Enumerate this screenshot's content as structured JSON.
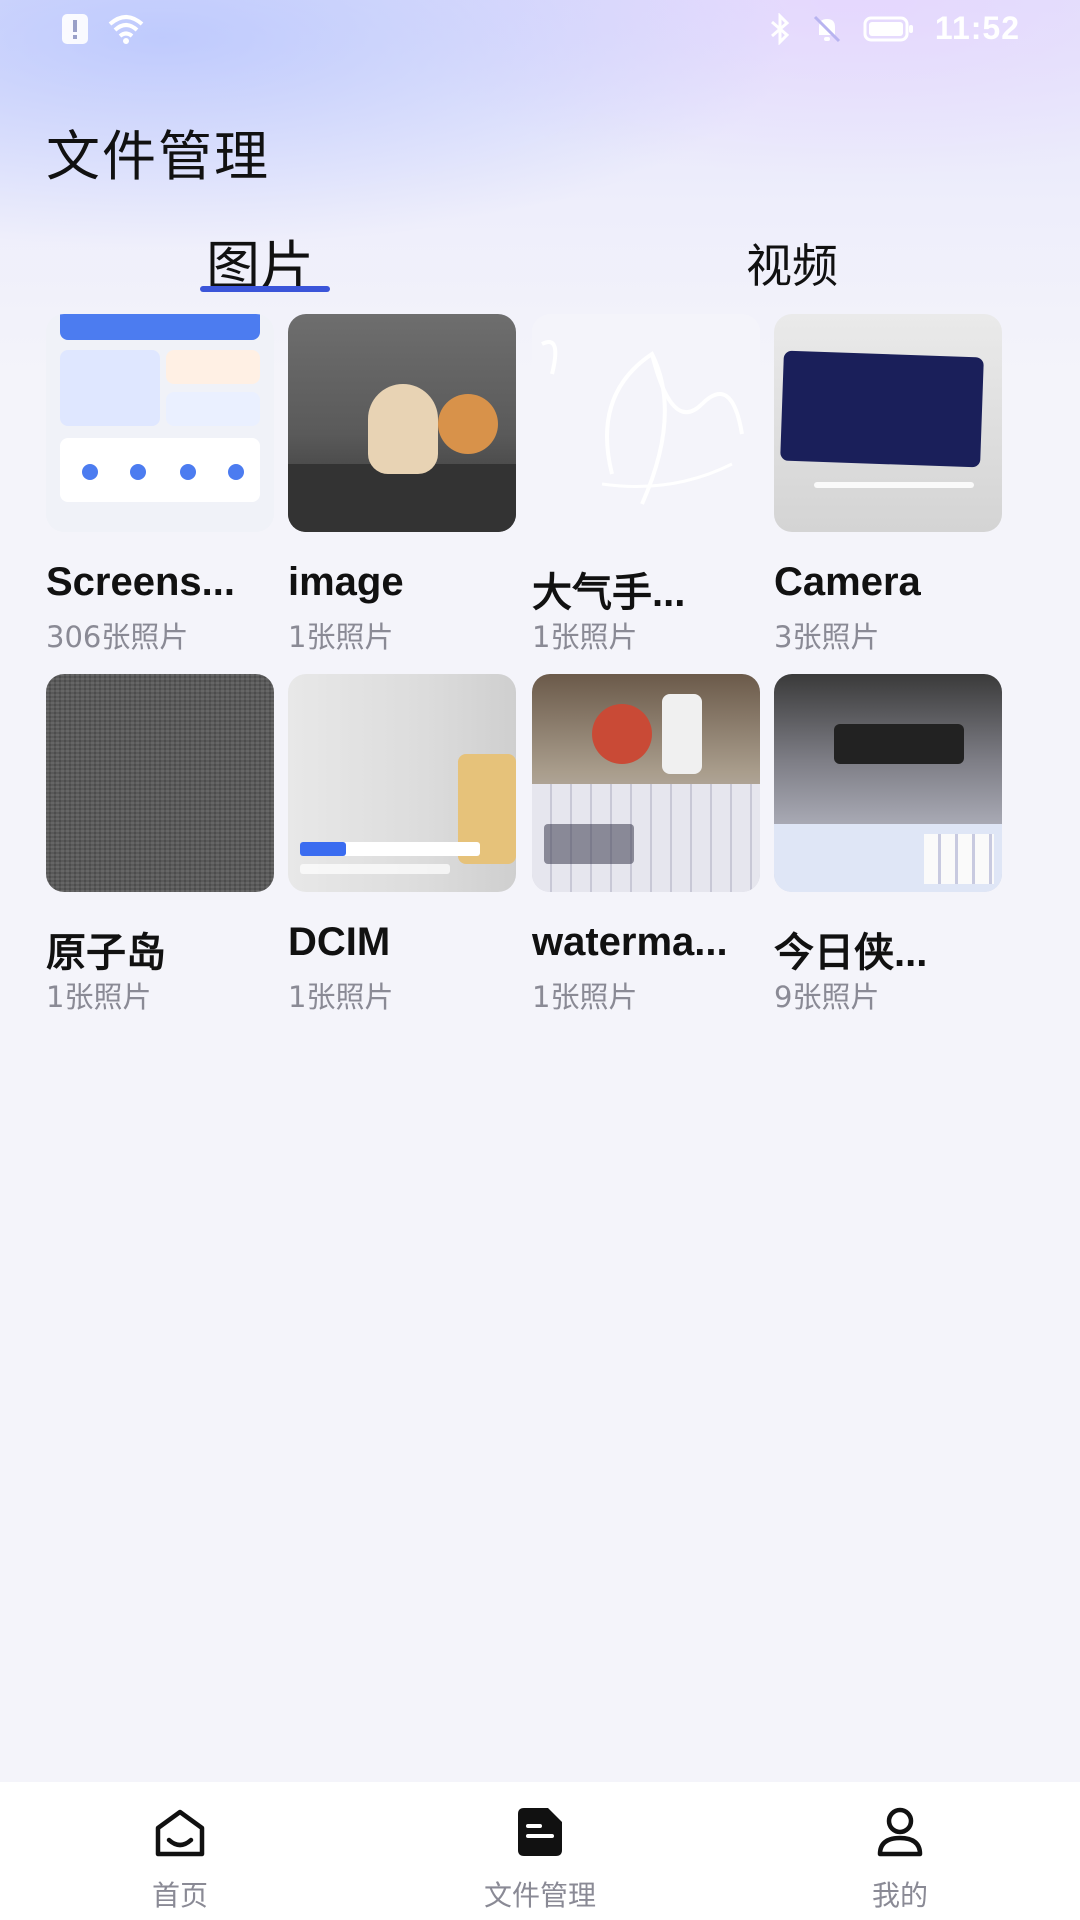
{
  "status_bar": {
    "time": "11:52",
    "icons": [
      "alert-icon",
      "wifi-icon",
      "bluetooth-icon",
      "mute-icon",
      "battery-icon"
    ]
  },
  "page": {
    "title": "文件管理"
  },
  "tabs": [
    {
      "label": "图片",
      "active": true
    },
    {
      "label": "视频",
      "active": false
    }
  ],
  "albums": [
    {
      "name": "Screens...",
      "count": "306张照片"
    },
    {
      "name": "image",
      "count": "1张照片"
    },
    {
      "name": "大气手...",
      "count": "1张照片"
    },
    {
      "name": "Camera",
      "count": "3张照片"
    },
    {
      "name": "原子岛",
      "count": "1张照片"
    },
    {
      "name": "DCIM",
      "count": "1张照片"
    },
    {
      "name": "waterma...",
      "count": "1张照片"
    },
    {
      "name": "今日侠...",
      "count": "9张照片"
    }
  ],
  "bottom_nav": [
    {
      "label": "首页",
      "icon": "home-icon",
      "active": false
    },
    {
      "label": "文件管理",
      "icon": "document-icon",
      "active": true
    },
    {
      "label": "我的",
      "icon": "person-icon",
      "active": false
    }
  ],
  "colors": {
    "accent": "#3b55d9",
    "text_primary": "#111111",
    "text_secondary": "#8a8a95",
    "background": "#f4f4fa"
  }
}
